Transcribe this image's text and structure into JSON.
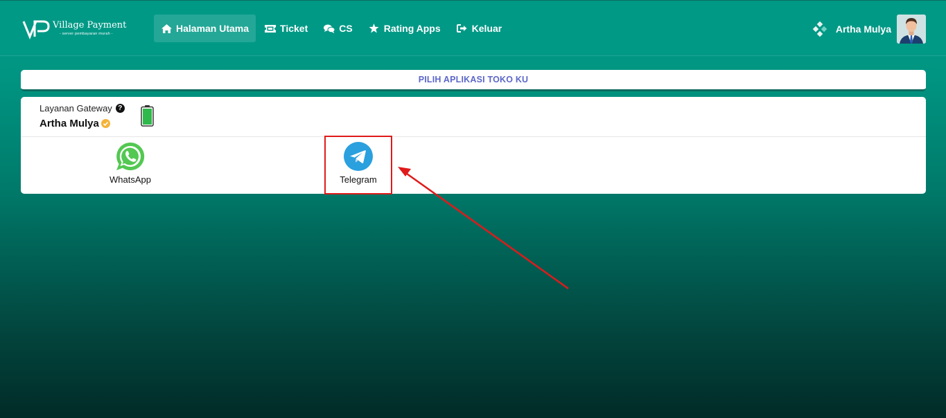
{
  "header": {
    "brand_name": "Village Payment",
    "brand_tagline": "- server pembayaran murah -",
    "nav": [
      {
        "label": "Halaman Utama",
        "icon": "home-icon",
        "active": true
      },
      {
        "label": "Ticket",
        "icon": "ticket-icon",
        "active": false
      },
      {
        "label": "CS",
        "icon": "chat-icon",
        "active": false
      },
      {
        "label": "Rating Apps",
        "icon": "star-icon",
        "active": false
      },
      {
        "label": "Keluar",
        "icon": "logout-icon",
        "active": false
      }
    ],
    "user_name": "Artha Mulya"
  },
  "banner": {
    "title": "PILIH APLIKASI TOKO KU"
  },
  "gateway": {
    "label": "Layanan Gateway",
    "name": "Artha Mulya",
    "battery_level": 1.0
  },
  "apps": [
    {
      "label": "WhatsApp",
      "icon": "whatsapp-icon"
    },
    {
      "label": "Telegram",
      "icon": "telegram-icon"
    }
  ],
  "colors": {
    "primary": "#009986",
    "banner_text": "#5b67c9",
    "highlight": "#e01a1a",
    "whatsapp": "#53c852",
    "telegram": "#2aa0de"
  }
}
